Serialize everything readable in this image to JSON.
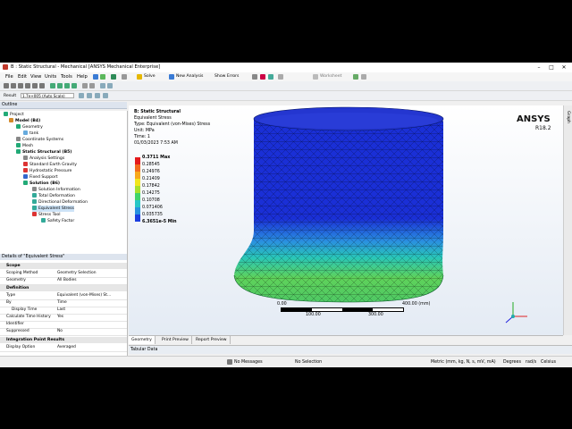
{
  "window": {
    "title": "B : Static Structural - Mechanical [ANSYS Mechanical Enterprise]"
  },
  "menu": [
    "File",
    "Edit",
    "View",
    "Units",
    "Tools",
    "Help"
  ],
  "toolbar1": {
    "solve": "Solve",
    "new_analysis": "New Analysis",
    "show_errors": "Show Errors",
    "worksheet": "Worksheet"
  },
  "toolbar3": {
    "result": "Result",
    "scale": "1.7e+005 (Auto Scale)"
  },
  "toolbar4": {
    "probe": "Probe",
    "display": "Display",
    "scoped": "Scoped Bodies"
  },
  "outline": {
    "header": "Outline",
    "items": [
      {
        "label": "Project"
      },
      {
        "label": "Model (B4)"
      },
      {
        "label": "Geometry"
      },
      {
        "label": "tank"
      },
      {
        "label": "Coordinate Systems"
      },
      {
        "label": "Mesh"
      },
      {
        "label": "Static Structural (B5)"
      },
      {
        "label": "Analysis Settings"
      },
      {
        "label": "Standard Earth Gravity"
      },
      {
        "label": "Hydrostatic Pressure"
      },
      {
        "label": "Fixed Support"
      },
      {
        "label": "Solution (B6)"
      },
      {
        "label": "Solution Information"
      },
      {
        "label": "Total Deformation"
      },
      {
        "label": "Directional Deformation"
      },
      {
        "label": "Equivalent Stress"
      },
      {
        "label": "Stress Tool"
      },
      {
        "label": "Safety Factor"
      }
    ]
  },
  "details": {
    "header": "Details of \"Equivalent Stress\"",
    "scope_title": "Scope",
    "scope": [
      {
        "key": "Scoping Method",
        "value": "Geometry Selection"
      },
      {
        "key": "Geometry",
        "value": "All Bodies"
      }
    ],
    "definition_title": "Definition",
    "definition": [
      {
        "key": "Type",
        "value": "Equivalent (von-Mises) St..."
      },
      {
        "key": "By",
        "value": "Time"
      },
      {
        "key": "Display Time",
        "value": "Last"
      },
      {
        "key": "Calculate Time History",
        "value": "Yes"
      },
      {
        "key": "Identifier",
        "value": ""
      },
      {
        "key": "Suppressed",
        "value": "No"
      }
    ],
    "integration_title": "Integration Point Results",
    "integration": [
      {
        "key": "Display Option",
        "value": "Averaged"
      }
    ]
  },
  "result_info": {
    "line1": "B: Static Structural",
    "line2": "Equivalent Stress",
    "line3": "Type: Equivalent (von-Mises) Stress",
    "line4": "Unit: MPa",
    "line5": "Time: 1",
    "line6": "01/03/2023 7:53 AM"
  },
  "legend": {
    "max_label": "0.3711 Max",
    "min_label": "6.3651e-5 Min",
    "values": [
      "0.28545",
      "0.24976",
      "0.21409",
      "0.17842",
      "0.14275",
      "0.10708",
      "0.071406",
      "0.035735"
    ],
    "colors": [
      "#e41a1c",
      "#f26b1d",
      "#f7a81c",
      "#f1e51c",
      "#a6e02c",
      "#3fd46a",
      "#27c6c6",
      "#2791e0",
      "#1b3ee0"
    ]
  },
  "logo": {
    "brand": "ANSYS",
    "version": "R18.2"
  },
  "scalebar": {
    "t0": "0.00",
    "t1": "400.00 (mm)",
    "t2": "100.00",
    "t3": "300.00"
  },
  "tabs": [
    "Geometry",
    "Print Preview",
    "Report Preview"
  ],
  "tabular": {
    "title": "Tabular Data"
  },
  "side_tab": "Graph",
  "status": {
    "messages": "No Messages",
    "selection": "No Selection",
    "units": "Metric (mm, kg, N, s, mV, mA)",
    "degrees": "Degrees",
    "rads": "rad/s",
    "temp": "Celsius"
  }
}
